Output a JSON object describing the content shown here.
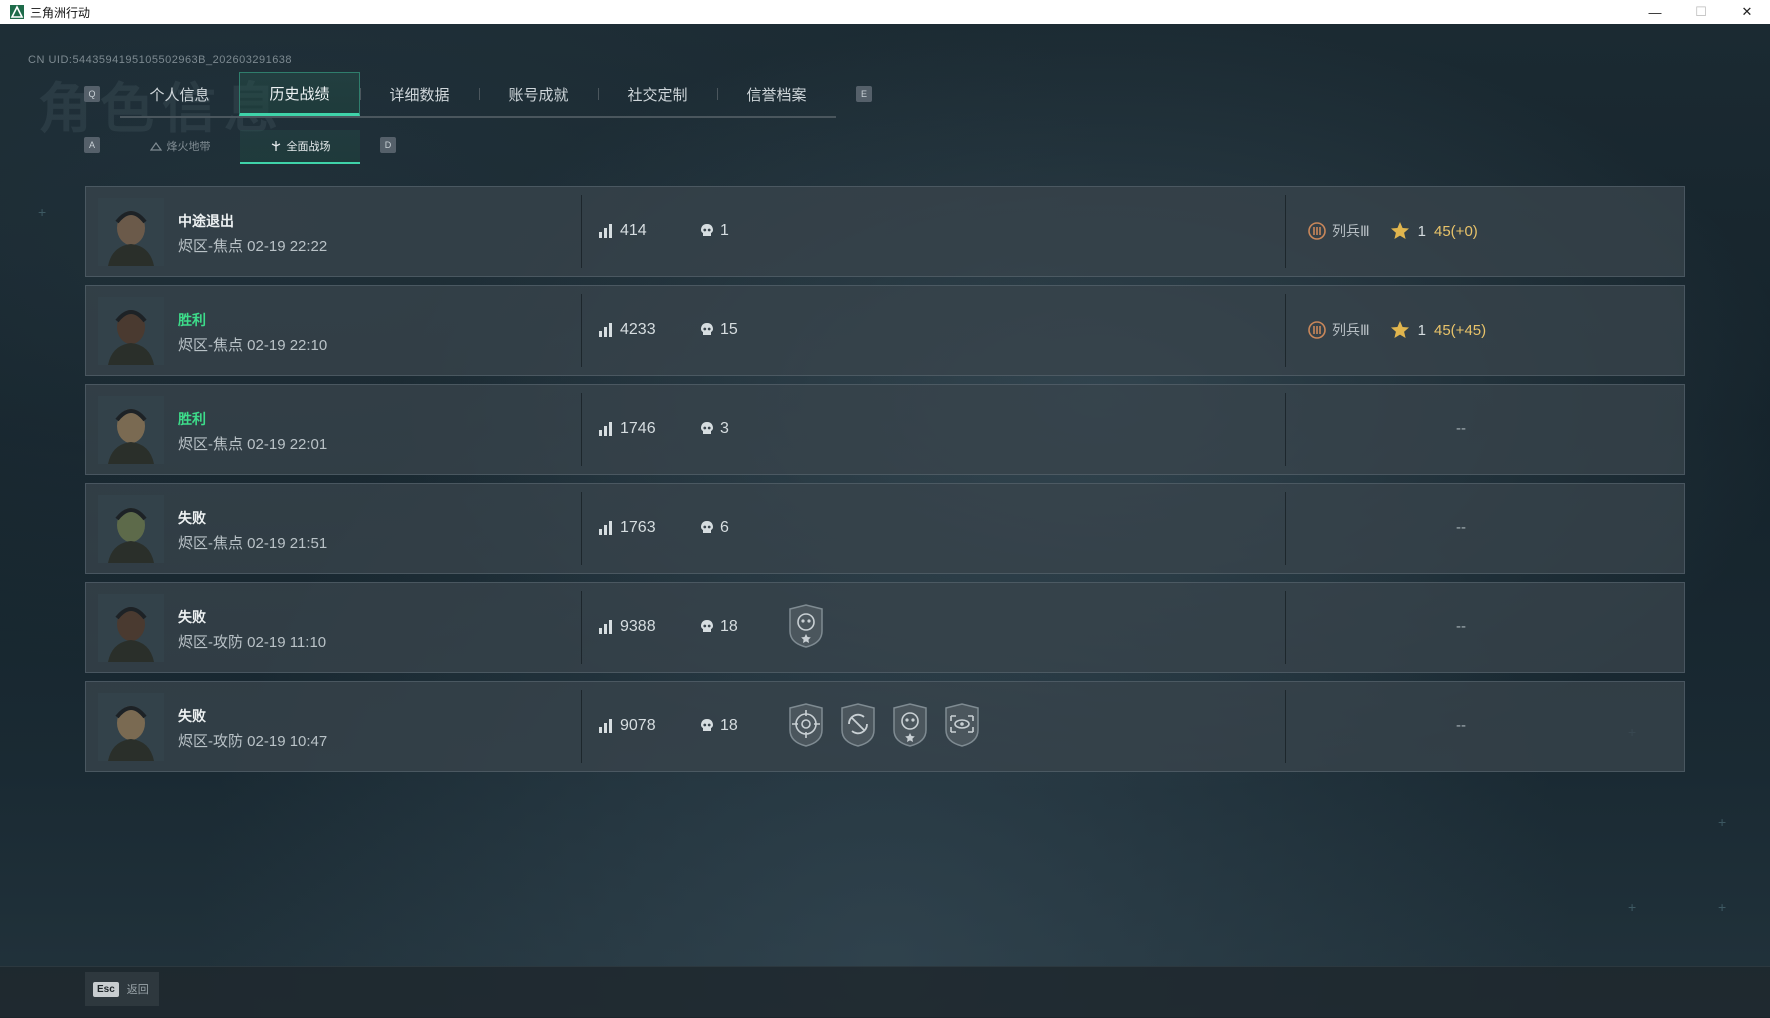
{
  "window": {
    "title": "三角洲行动",
    "minimize": "—",
    "maximize": "☐",
    "close": "✕"
  },
  "header": {
    "uid": "CN UID:5443594195105502963B_202603291638",
    "bg_title": "角色信息"
  },
  "tabs": {
    "prev_key": "Q",
    "next_key": "E",
    "items": [
      {
        "label": "个人信息"
      },
      {
        "label": "历史战绩"
      },
      {
        "label": "详细数据"
      },
      {
        "label": "账号成就"
      },
      {
        "label": "社交定制"
      },
      {
        "label": "信誉档案"
      }
    ],
    "active_index": 1
  },
  "subtabs": {
    "prev_key": "A",
    "next_key": "D",
    "items": [
      {
        "label": "烽火地带",
        "icon": "fire-zone-icon"
      },
      {
        "label": "全面战场",
        "icon": "battlefield-icon"
      }
    ],
    "active_index": 1
  },
  "matches": [
    {
      "result": "中途退出",
      "result_type": "quit",
      "mode": "烬区-焦点",
      "time": "02-19 22:22",
      "score": "414",
      "kills": "1",
      "badges": [],
      "rank": "列兵Ⅲ",
      "stars": "1",
      "points": "45(+0)",
      "empty": ""
    },
    {
      "result": "胜利",
      "result_type": "win",
      "mode": "烬区-焦点",
      "time": "02-19 22:10",
      "score": "4233",
      "kills": "15",
      "badges": [],
      "rank": "列兵Ⅲ",
      "stars": "1",
      "points": "45(+45)",
      "empty": ""
    },
    {
      "result": "胜利",
      "result_type": "win",
      "mode": "烬区-焦点",
      "time": "02-19 22:01",
      "score": "1746",
      "kills": "3",
      "badges": [],
      "rank": "",
      "stars": "",
      "points": "",
      "empty": "--"
    },
    {
      "result": "失败",
      "result_type": "loss",
      "mode": "烬区-焦点",
      "time": "02-19 21:51",
      "score": "1763",
      "kills": "6",
      "badges": [],
      "rank": "",
      "stars": "",
      "points": "",
      "empty": "--"
    },
    {
      "result": "失败",
      "result_type": "loss",
      "mode": "烬区-攻防",
      "time": "02-19 11:10",
      "score": "9388",
      "kills": "18",
      "badges": [
        "skull-star-badge"
      ],
      "rank": "",
      "stars": "",
      "points": "",
      "empty": "--"
    },
    {
      "result": "失败",
      "result_type": "loss",
      "mode": "烬区-攻防",
      "time": "02-19 10:47",
      "score": "9078",
      "kills": "18",
      "badges": [
        "target-badge",
        "crosshair-badge",
        "skull-star-badge",
        "eye-scope-badge"
      ],
      "rank": "",
      "stars": "",
      "points": "",
      "empty": "--"
    }
  ],
  "footer": {
    "esc_key": "Esc",
    "back_label": "返回"
  },
  "colors": {
    "accent": "#3fd3a9",
    "win": "#3ddc8a",
    "points": "#e8c36a"
  }
}
